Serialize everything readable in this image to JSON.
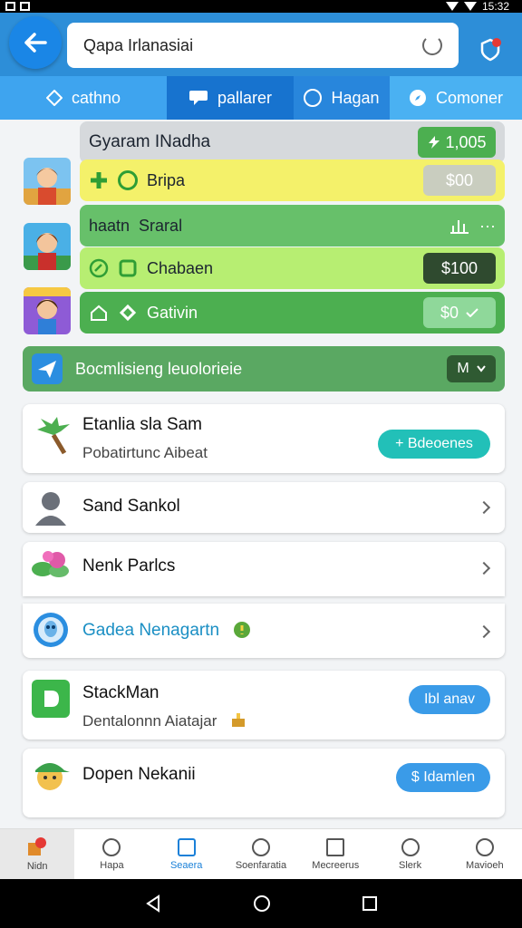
{
  "status": {
    "time": "15:32"
  },
  "header": {
    "search_text": "Qapa Irlanasiai"
  },
  "tabs": [
    {
      "label": "cathno"
    },
    {
      "label": "pallarer"
    },
    {
      "label": "Hagan"
    },
    {
      "label": "Comoner"
    }
  ],
  "game_panel": {
    "title": "Gyaram INadha",
    "title_value": "1,005",
    "rows": [
      {
        "label": "Bripa",
        "value": "$00"
      },
      {
        "label_left": "haatn",
        "label": "Sraral",
        "value": ""
      },
      {
        "label": "Chabaen",
        "value": "$100"
      },
      {
        "label": "Gativin",
        "value": "$0"
      }
    ]
  },
  "banner": {
    "label": "Bocmlisieng leuolorieie",
    "badge": "M"
  },
  "list": [
    {
      "title": "Etanlia sla Sam",
      "subtitle": "Pobatirtunc Aibeat",
      "button": "+ Bdeoenes"
    },
    {
      "title": "Sand Sankol"
    },
    {
      "title": "Nenk Parlcs"
    },
    {
      "title": "Gadea Nenagartn"
    },
    {
      "title": "StackMan",
      "subtitle": "Dentalonnn Aiatajar",
      "button": "Ibl anav"
    },
    {
      "title": "Dopen Nekanii",
      "button": "$ Idamlen"
    }
  ],
  "bottom_nav": [
    {
      "label": "Nidn"
    },
    {
      "label": "Hapa"
    },
    {
      "label": "Seaera"
    },
    {
      "label": "Soenfaratia"
    },
    {
      "label": "Mecreerus"
    },
    {
      "label": "Slerk"
    },
    {
      "label": "Mavioeh"
    }
  ],
  "colors": {
    "header_blue": "#2d8ed8",
    "accent_teal": "#22c0b8",
    "accent_blue": "#3a9be8",
    "green": "#4caf50",
    "yellow": "#f4f16a"
  }
}
